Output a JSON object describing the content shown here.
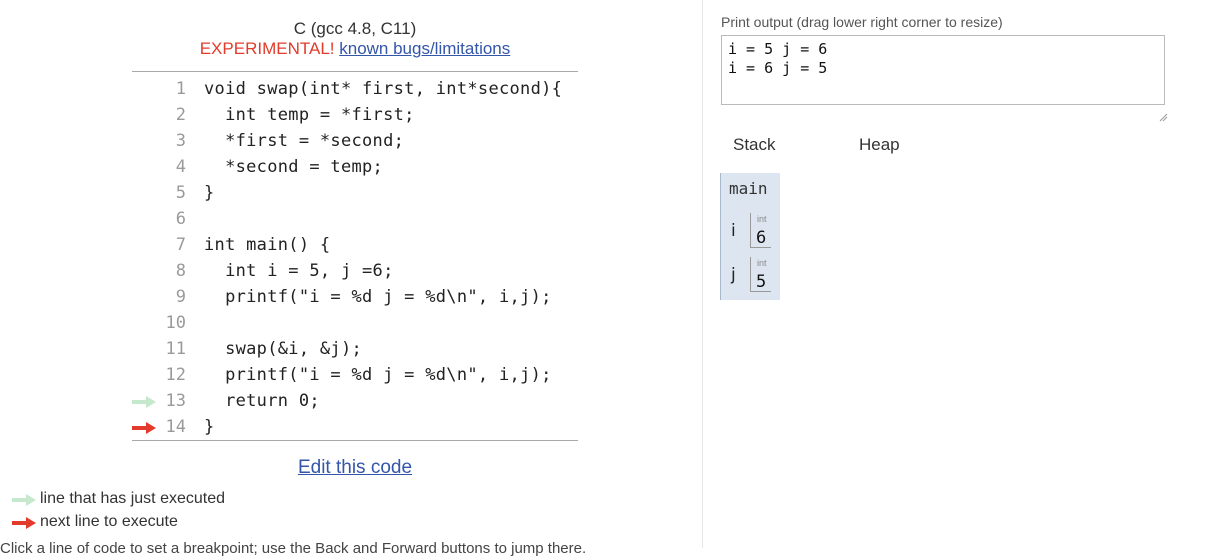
{
  "header": {
    "language": "C (gcc 4.8, C11)",
    "experimental_label": "EXPERIMENTAL!",
    "bugs_link": "known bugs/limitations"
  },
  "code": {
    "lines": [
      {
        "no": "1",
        "text": "void swap(int* first, int*second){"
      },
      {
        "no": "2",
        "text": "  int temp = *first;"
      },
      {
        "no": "3",
        "text": "  *first = *second;"
      },
      {
        "no": "4",
        "text": "  *second = temp;"
      },
      {
        "no": "5",
        "text": "}"
      },
      {
        "no": "6",
        "text": ""
      },
      {
        "no": "7",
        "text": "int main() {"
      },
      {
        "no": "8",
        "text": "  int i = 5, j =6;"
      },
      {
        "no": "9",
        "text": "  printf(\"i = %d j = %d\\n\", i,j);"
      },
      {
        "no": "10",
        "text": ""
      },
      {
        "no": "11",
        "text": "  swap(&i, &j);"
      },
      {
        "no": "12",
        "text": "  printf(\"i = %d j = %d\\n\", i,j);"
      },
      {
        "no": "13",
        "text": "  return 0;"
      },
      {
        "no": "14",
        "text": "}"
      }
    ],
    "just_executed_line": "13",
    "next_line": "14"
  },
  "edit_link": "Edit this code",
  "legend": {
    "executed": "line that has just executed",
    "next": "next line to execute"
  },
  "cutoff_text": "Click a line of code to set a breakpoint; use the Back and Forward buttons to jump there.",
  "output": {
    "label": "Print output (drag lower right corner to resize)",
    "text": "i = 5 j = 6\ni = 6 j = 5"
  },
  "visualization": {
    "stack_header": "Stack",
    "heap_header": "Heap",
    "frame_name": "main",
    "vars": [
      {
        "name": "i",
        "type": "int",
        "value": "6"
      },
      {
        "name": "j",
        "type": "int",
        "value": "5"
      }
    ]
  },
  "colors": {
    "executed_arrow": "#c6e8cc",
    "next_arrow": "#e23b2b",
    "link": "#3355aa",
    "frame_bg": "#dde6f0"
  }
}
